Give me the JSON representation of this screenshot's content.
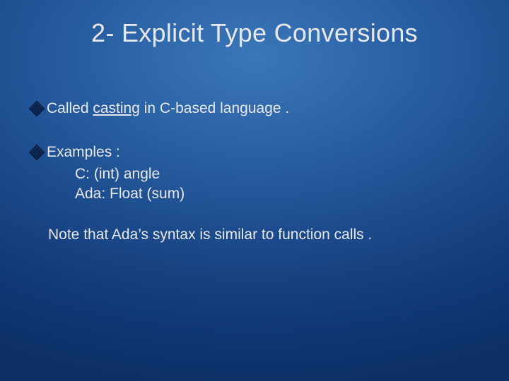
{
  "title": "2- Explicit Type Conversions",
  "bullet1": {
    "prefix": "Called ",
    "underlined": "casting",
    "suffix": " in C-based language ."
  },
  "bullet2": {
    "label": " Examples :",
    "line1": "C: (int) angle",
    "line2": "Ada: Float (sum)"
  },
  "note": "Note that Ada’s syntax is similar to function calls ."
}
